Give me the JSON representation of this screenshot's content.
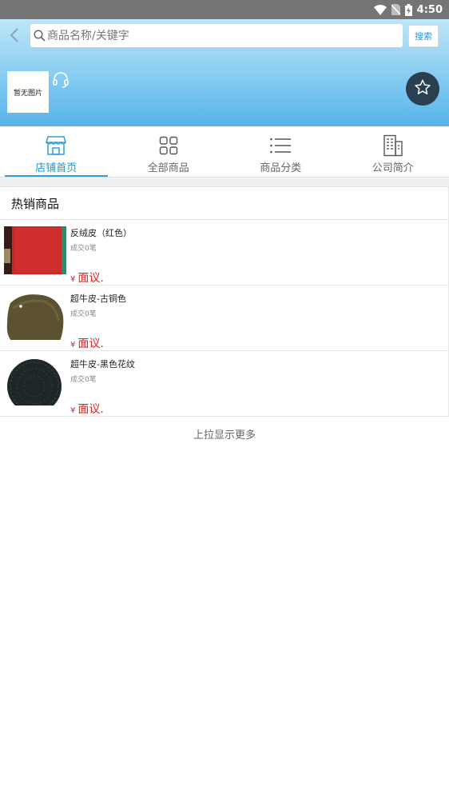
{
  "status_bar": {
    "time": "4:50",
    "icons": [
      "wifi-icon",
      "no-sim-icon",
      "battery-charging-icon"
    ]
  },
  "header": {
    "search": {
      "placeholder": "商品名称/关键字",
      "value": ""
    },
    "search_button_label": "搜索",
    "shop_logo_text": "暂无图片",
    "icons": {
      "back": "chevron-left-icon",
      "search": "search-icon",
      "service": "headset-icon",
      "favorite": "star-icon"
    }
  },
  "tabs": [
    {
      "label": "店铺首页",
      "icon": "storefront-icon",
      "active": true
    },
    {
      "label": "全部商品",
      "icon": "grid-icon",
      "active": false
    },
    {
      "label": "商品分类",
      "icon": "list-icon",
      "active": false
    },
    {
      "label": "公司简介",
      "icon": "building-icon",
      "active": false
    }
  ],
  "section": {
    "title": "热销商品"
  },
  "products": [
    {
      "name": "反绒皮（红色）",
      "deals": "成交0笔",
      "currency": "¥",
      "price": "面议."
    },
    {
      "name": "超牛皮-古铜色",
      "deals": "成交0笔",
      "currency": "¥",
      "price": "面议."
    },
    {
      "name": "超牛皮-黑色花纹",
      "deals": "成交0笔",
      "currency": "¥",
      "price": "面议."
    }
  ],
  "load_more": "上拉显示更多",
  "colors": {
    "accent": "#2196d9",
    "price": "#e02020",
    "fav_bg": "#2b3f52"
  }
}
